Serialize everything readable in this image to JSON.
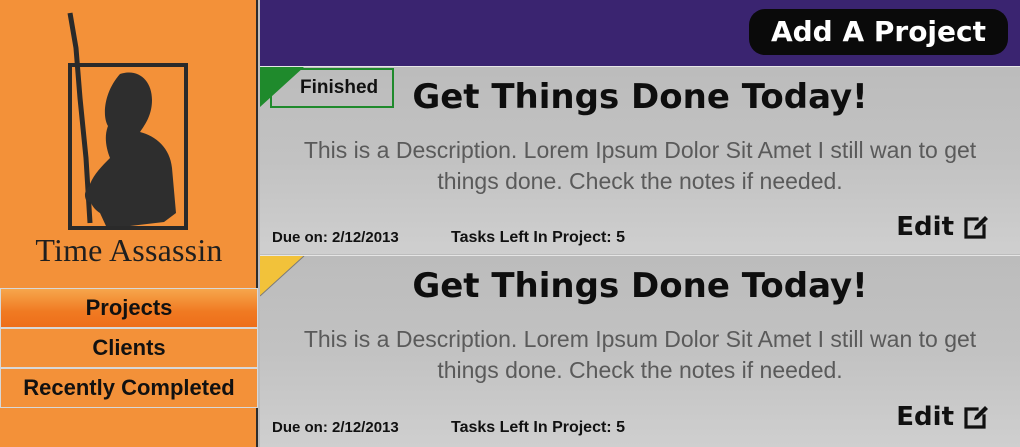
{
  "sidebar": {
    "brand": "Time Assassin",
    "nav": [
      {
        "label": "Projects",
        "active": true
      },
      {
        "label": "Clients",
        "active": false
      },
      {
        "label": "Recently Completed",
        "active": false
      }
    ]
  },
  "topbar": {
    "add_project_label": "Add A Project",
    "color": "#3a2470"
  },
  "projects": [
    {
      "status": "Finished",
      "status_color": "#1f8a2c",
      "title": "Get Things Done Today!",
      "description": "This is a Description. Lorem Ipsum Dolor Sit Amet I still wan to get things done. Check the notes if needed.",
      "due_on": "Due on: 2/12/2013",
      "tasks_left": "Tasks Left In Project: 5",
      "edit_label": "Edit"
    },
    {
      "status": "",
      "status_color": "#f2c23a",
      "title": "Get Things Done Today!",
      "description": "This is a Description. Lorem Ipsum Dolor Sit Amet I still wan to get things done. Check the notes if needed.",
      "due_on": "Due on: 2/12/2013",
      "tasks_left": "Tasks Left In Project: 5",
      "edit_label": "Edit"
    }
  ],
  "icons": {
    "logo": "assassin-silhouette-icon",
    "edit": "edit-icon"
  }
}
